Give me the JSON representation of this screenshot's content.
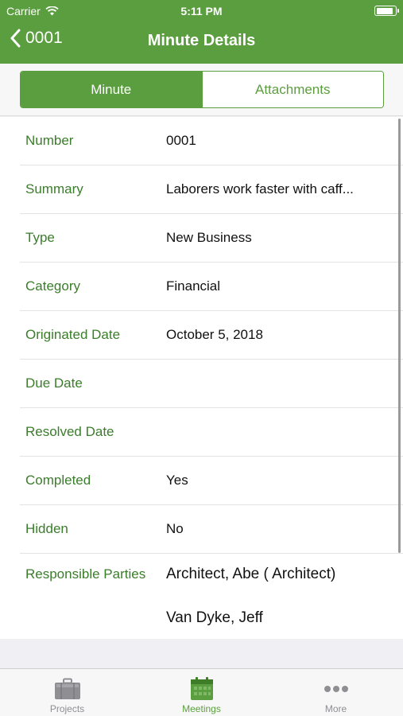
{
  "status_bar": {
    "carrier": "Carrier",
    "time": "5:11 PM",
    "battery_level": 0.9
  },
  "nav": {
    "back_label": "0001",
    "title": "Minute Details"
  },
  "segments": {
    "minute": "Minute",
    "attachments": "Attachments",
    "selected": "Minute"
  },
  "details": [
    {
      "label": "Number",
      "value": "0001"
    },
    {
      "label": "Summary",
      "value": "Laborers work faster with caff..."
    },
    {
      "label": "Type",
      "value": "New Business"
    },
    {
      "label": "Category",
      "value": "Financial"
    },
    {
      "label": "Originated Date",
      "value": "October 5, 2018"
    },
    {
      "label": "Due Date",
      "value": ""
    },
    {
      "label": "Resolved Date",
      "value": ""
    },
    {
      "label": "Completed",
      "value": "Yes"
    },
    {
      "label": "Hidden",
      "value": "No"
    }
  ],
  "responsible": {
    "label": "Responsible Parties",
    "parties": [
      "Architect, Abe ( Architect)",
      "Van Dyke, Jeff"
    ]
  },
  "tabbar": {
    "projects": {
      "label": "Projects",
      "icon": "briefcase-icon"
    },
    "meetings": {
      "label": "Meetings",
      "icon": "calendar-icon",
      "active": true
    },
    "more": {
      "label": "More",
      "icon": "more-dots-icon"
    }
  },
  "colors": {
    "brand_green": "#5b9e3f",
    "label_green": "#3a7d2a",
    "tab_inactive": "#8e8e93"
  }
}
